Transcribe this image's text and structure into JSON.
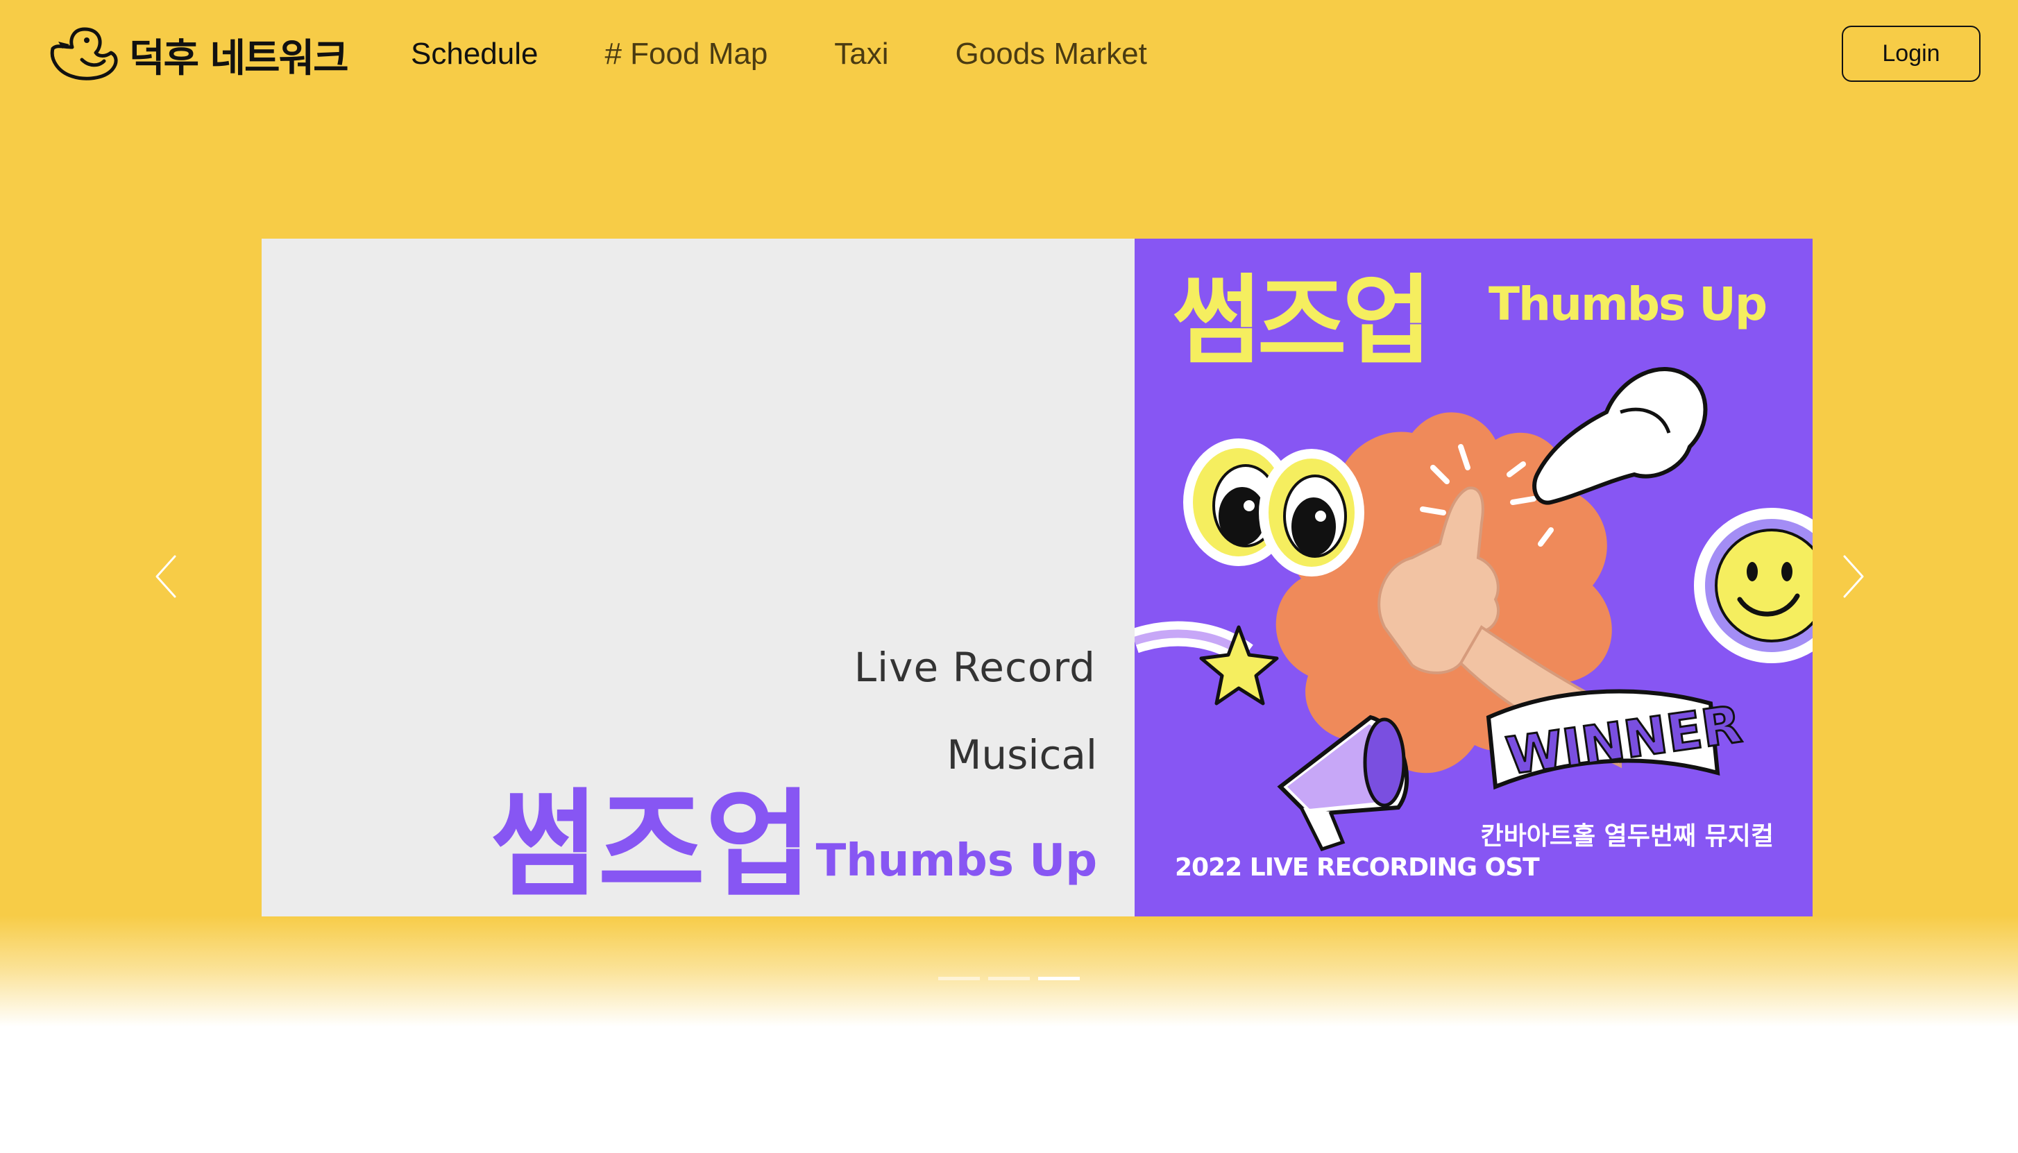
{
  "header": {
    "logo_text": "덕후 네트워크",
    "nav": [
      {
        "label": "Schedule",
        "active": true
      },
      {
        "label": "# Food Map",
        "active": false
      },
      {
        "label": "Taxi",
        "active": false
      },
      {
        "label": "Goods Market",
        "active": false
      }
    ],
    "login_label": "Login"
  },
  "hero": {
    "background_color": "#f7cc47",
    "slide": {
      "type_label": "Live Record",
      "genre_label": "Musical",
      "title_kr": "썸즈업",
      "title_en": "Thumbs Up",
      "accent_color": "#8756f3"
    },
    "poster": {
      "title_kr": "썸즈업",
      "title_en": "Thumbs Up",
      "sticker_text": "WINNER",
      "subtitle_kr": "칸바아트홀 열두번째 뮤지컬",
      "subtitle_en": "2022 LIVE RECORDING OST",
      "background_color": "#8756f3",
      "text_color": "#f5ee5f"
    },
    "arrows": {
      "prev": "chevron-left-icon",
      "next": "chevron-right-icon"
    },
    "pagination": {
      "count": 3,
      "active_index": 2
    }
  }
}
